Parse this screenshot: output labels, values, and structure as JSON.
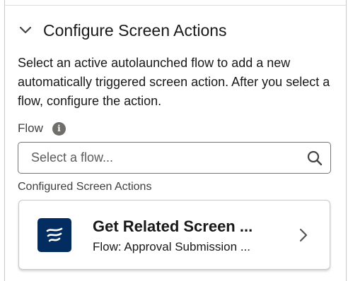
{
  "section": {
    "title": "Configure Screen Actions",
    "expanded": true,
    "description": "Select an active autolaunched flow to add a new automatically triggered screen action. After you select a flow, configure the action."
  },
  "flow_field": {
    "label": "Flow",
    "placeholder": "Select a flow...",
    "value": ""
  },
  "configured": {
    "label": "Configured Screen Actions",
    "items": [
      {
        "title": "Get Related Screen ...",
        "subtitle": "Flow: Approval Submission ..."
      }
    ]
  },
  "colors": {
    "logo_background": "#032d60",
    "text": "#181818",
    "border": "#c9c9c9"
  },
  "icons": {
    "section_toggle": "chevron-down-icon",
    "info": "info-icon",
    "search": "search-icon",
    "flow_logo": "flow-icon",
    "card_open": "chevron-right-icon"
  }
}
